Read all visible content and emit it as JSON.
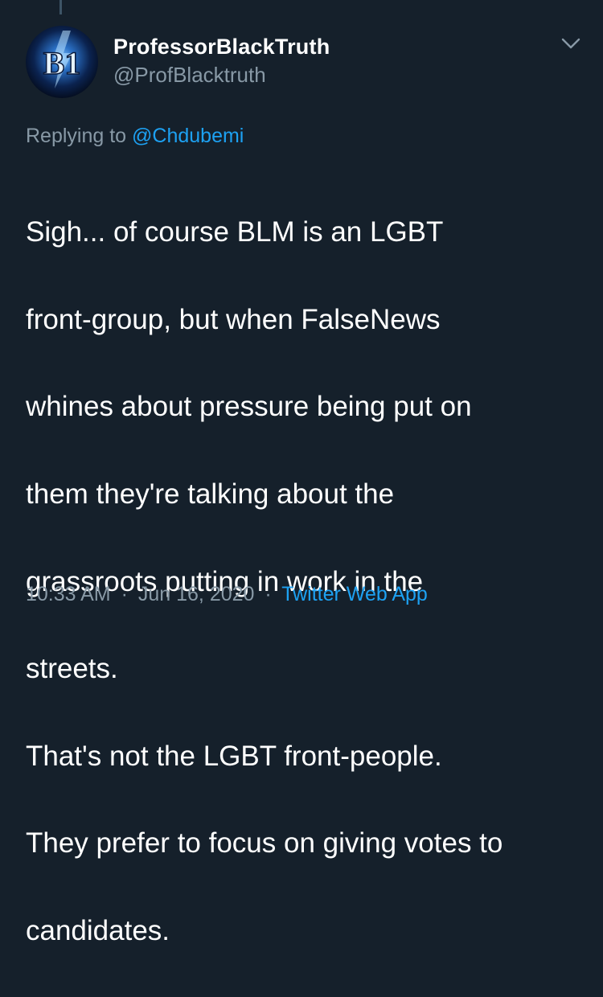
{
  "tweet": {
    "author": {
      "display_name": "ProfessorBlackTruth",
      "handle": "@ProfBlacktruth",
      "avatar_text": "B1",
      "avatar_icon": "blue-lightning-logo"
    },
    "more_icon": "chevron-down-icon",
    "reply": {
      "prefix": "Replying to",
      "mention": "@Chdubemi"
    },
    "text_lines": [
      "Sigh... of course BLM is an LGBT",
      "front-group, but when FalseNews",
      "whines about pressure being put on",
      "them they're talking about the",
      "grassroots putting in work in the",
      "streets.",
      "That's not the LGBT front-people.",
      "They prefer to focus on giving votes to",
      "candidates."
    ],
    "time": "10:33 AM",
    "date": "Jun 16, 2020",
    "separator": "·",
    "source": "Twitter Web App"
  },
  "colors": {
    "background": "#15202b",
    "primary_text": "#ffffff",
    "secondary_text": "#8899a6",
    "accent": "#1da1f2"
  }
}
